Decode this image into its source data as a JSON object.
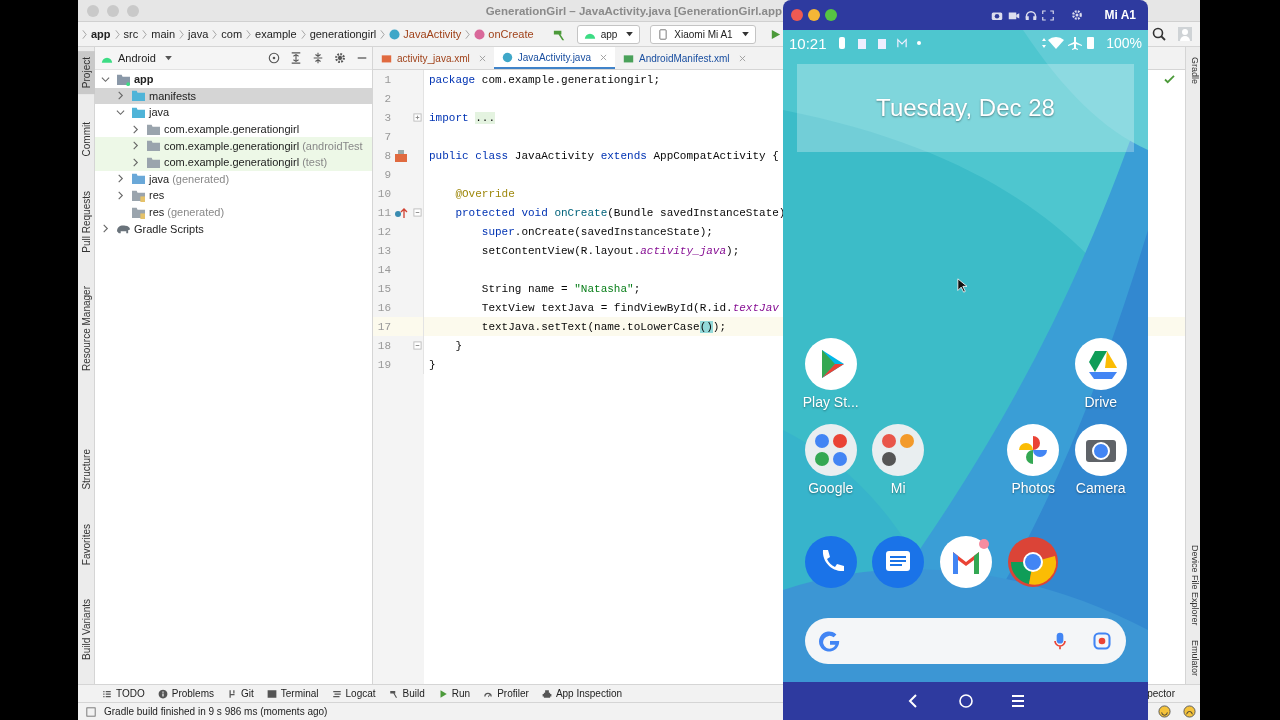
{
  "window": {
    "title": "GenerationGirl – JavaActivity.java [GenerationGirl.app"
  },
  "breadcrumbs": [
    {
      "label": "app",
      "kind": "module"
    },
    {
      "label": "src",
      "kind": "dir"
    },
    {
      "label": "main",
      "kind": "dir"
    },
    {
      "label": "java",
      "kind": "dir"
    },
    {
      "label": "com",
      "kind": "dir"
    },
    {
      "label": "example",
      "kind": "dir"
    },
    {
      "label": "generationgirl",
      "kind": "dir"
    },
    {
      "label": "JavaActivity",
      "kind": "class"
    },
    {
      "label": "onCreate",
      "kind": "method"
    }
  ],
  "run_config": "app",
  "device": "Xiaomi Mi A1",
  "left_tools_top": [
    {
      "label": "Project",
      "selected": true
    },
    {
      "label": "Commit",
      "selected": false
    },
    {
      "label": "Pull Requests",
      "selected": false
    },
    {
      "label": "Resource Manager",
      "selected": false
    }
  ],
  "left_tools_bottom": [
    {
      "label": "Structure",
      "selected": false
    },
    {
      "label": "Favorites",
      "selected": false
    },
    {
      "label": "Build Variants",
      "selected": false
    }
  ],
  "project_panel": {
    "view": "Android",
    "tree": [
      {
        "label": "app",
        "kind": "module",
        "expanded": true,
        "selected": false,
        "children": [
          {
            "label": "manifests",
            "kind": "folder",
            "expanded": false,
            "selected": true
          },
          {
            "label": "java",
            "kind": "folder",
            "expanded": true,
            "selected": false,
            "children": [
              {
                "label": "com.example.generationgirl",
                "kind": "package",
                "expanded": false,
                "selected": false
              },
              {
                "label": "com.example.generationgirl",
                "suffix": "(androidTest",
                "kind": "test_package",
                "expanded": false,
                "selected": false
              },
              {
                "label": "com.example.generationgirl",
                "suffix": "(test)",
                "kind": "test_package",
                "expanded": false,
                "selected": false
              }
            ]
          },
          {
            "label": "java",
            "suffix": "(generated)",
            "kind": "generated",
            "expanded": false,
            "selected": false
          },
          {
            "label": "res",
            "kind": "res",
            "expanded": false,
            "selected": false
          },
          {
            "label": "res",
            "suffix": "(generated)",
            "kind": "res",
            "selected": false
          }
        ]
      },
      {
        "label": "Gradle Scripts",
        "kind": "gradle",
        "expanded": false,
        "selected": false
      }
    ]
  },
  "editor": {
    "tabs": [
      {
        "label": "activity_java.xml",
        "kind": "xml",
        "selected": false
      },
      {
        "label": "JavaActivity.java",
        "kind": "class",
        "selected": true
      },
      {
        "label": "AndroidManifest.xml",
        "kind": "manifest",
        "selected": false
      }
    ],
    "lines": [
      {
        "number": "1",
        "kind": "code",
        "current": false,
        "tokens": [
          {
            "text": "package ",
            "kind": "keyword"
          },
          {
            "text": "com.example.generationgirl;",
            "kind": "plain"
          }
        ]
      },
      {
        "number": "2",
        "kind": "code",
        "current": false
      },
      {
        "number": "3",
        "kind": "code",
        "current": false,
        "has_fold": true,
        "collapsed": true,
        "tokens": [
          {
            "text": "import ",
            "kind": "keyword"
          },
          {
            "text": "...",
            "kind": "folded"
          }
        ]
      },
      {
        "number": "7",
        "kind": "code",
        "current": false
      },
      {
        "number": "8",
        "kind": "layout_link",
        "current": false,
        "tokens": [
          {
            "text": "public class ",
            "kind": "keyword"
          },
          {
            "text": "JavaActivity ",
            "kind": "plain"
          },
          {
            "text": "extends ",
            "kind": "keyword"
          },
          {
            "text": "AppCompatActivity {",
            "kind": "plain"
          }
        ]
      },
      {
        "number": "9",
        "kind": "code",
        "current": false
      },
      {
        "number": "10",
        "kind": "code",
        "current": false,
        "tokens": [
          {
            "text": "    @Override",
            "kind": "annotation"
          }
        ]
      },
      {
        "number": "11",
        "kind": "override",
        "current": false,
        "has_fold": true,
        "collapsed": false,
        "tokens": [
          {
            "text": "    protected void ",
            "kind": "keyword"
          },
          {
            "text": "onCreate",
            "kind": "method"
          },
          {
            "text": "(Bundle savedInstanceState)",
            "kind": "plain"
          }
        ]
      },
      {
        "number": "12",
        "kind": "code",
        "current": false,
        "tokens": [
          {
            "text": "        super",
            "kind": "keyword"
          },
          {
            "text": ".onCreate(savedInstanceState);",
            "kind": "plain"
          }
        ]
      },
      {
        "number": "13",
        "kind": "code",
        "current": false,
        "tokens": [
          {
            "text": "        setContentView(R.layout.",
            "kind": "plain"
          },
          {
            "text": "activity_java",
            "kind": "field"
          },
          {
            "text": ");",
            "kind": "plain"
          }
        ]
      },
      {
        "number": "14",
        "kind": "code",
        "current": false
      },
      {
        "number": "15",
        "kind": "code",
        "current": false,
        "tokens": [
          {
            "text": "        String name = ",
            "kind": "plain"
          },
          {
            "text": "\"Natasha\"",
            "kind": "string"
          },
          {
            "text": ";",
            "kind": "plain"
          }
        ]
      },
      {
        "number": "16",
        "kind": "code",
        "current": false,
        "tokens": [
          {
            "text": "        TextView textJava = findViewById(R.id.",
            "kind": "plain"
          },
          {
            "text": "textJav",
            "kind": "field"
          }
        ]
      },
      {
        "number": "17",
        "kind": "code",
        "current": true,
        "tokens": [
          {
            "text": "        textJava.setText(name.toLowerCase",
            "kind": "plain"
          },
          {
            "text": "()",
            "kind": "match"
          },
          {
            "text": ");",
            "kind": "plain"
          }
        ]
      },
      {
        "number": "18",
        "kind": "code",
        "current": false,
        "has_fold": true,
        "collapsed": false,
        "tokens": [
          {
            "text": "    }",
            "kind": "plain"
          }
        ]
      },
      {
        "number": "19",
        "kind": "code",
        "current": false,
        "tokens": [
          {
            "text": "}",
            "kind": "plain"
          }
        ]
      }
    ]
  },
  "right_tools": [
    {
      "label": "Gradle"
    },
    {
      "label": "Device File Explorer"
    },
    {
      "label": "Emulator"
    }
  ],
  "bottom_tools": [
    {
      "label": "TODO",
      "kind": "todo"
    },
    {
      "label": "Problems",
      "kind": "problems"
    },
    {
      "label": "Git",
      "kind": "git"
    },
    {
      "label": "Terminal",
      "kind": "terminal"
    },
    {
      "label": "Logcat",
      "kind": "logcat"
    },
    {
      "label": "Build",
      "kind": "build"
    },
    {
      "label": "Run",
      "kind": "run"
    },
    {
      "label": "Profiler",
      "kind": "profiler"
    },
    {
      "label": "App Inspection",
      "kind": "inspection"
    }
  ],
  "bottom_tools_right": "pector",
  "status_bar": {
    "message": "Gradle build finished in 9 s 986 ms (moments ago)"
  },
  "emulator": {
    "title": "Mi A1",
    "time": "10:21",
    "battery": "100%",
    "date_widget": "Tuesday, Dec 28",
    "app_rows": [
      [
        {
          "label": "Play St...",
          "kind": "play"
        },
        {
          "label": "Drive",
          "kind": "drive"
        }
      ],
      [
        {
          "label": "Google",
          "kind": "google_folder"
        },
        {
          "label": "Mi",
          "kind": "mi_folder"
        },
        {
          "label": "Photos",
          "kind": "photos"
        },
        {
          "label": "Camera",
          "kind": "camera"
        }
      ]
    ],
    "dock": [
      {
        "kind": "phone"
      },
      {
        "kind": "messages"
      },
      {
        "kind": "gmail"
      },
      {
        "kind": "chrome"
      }
    ]
  }
}
